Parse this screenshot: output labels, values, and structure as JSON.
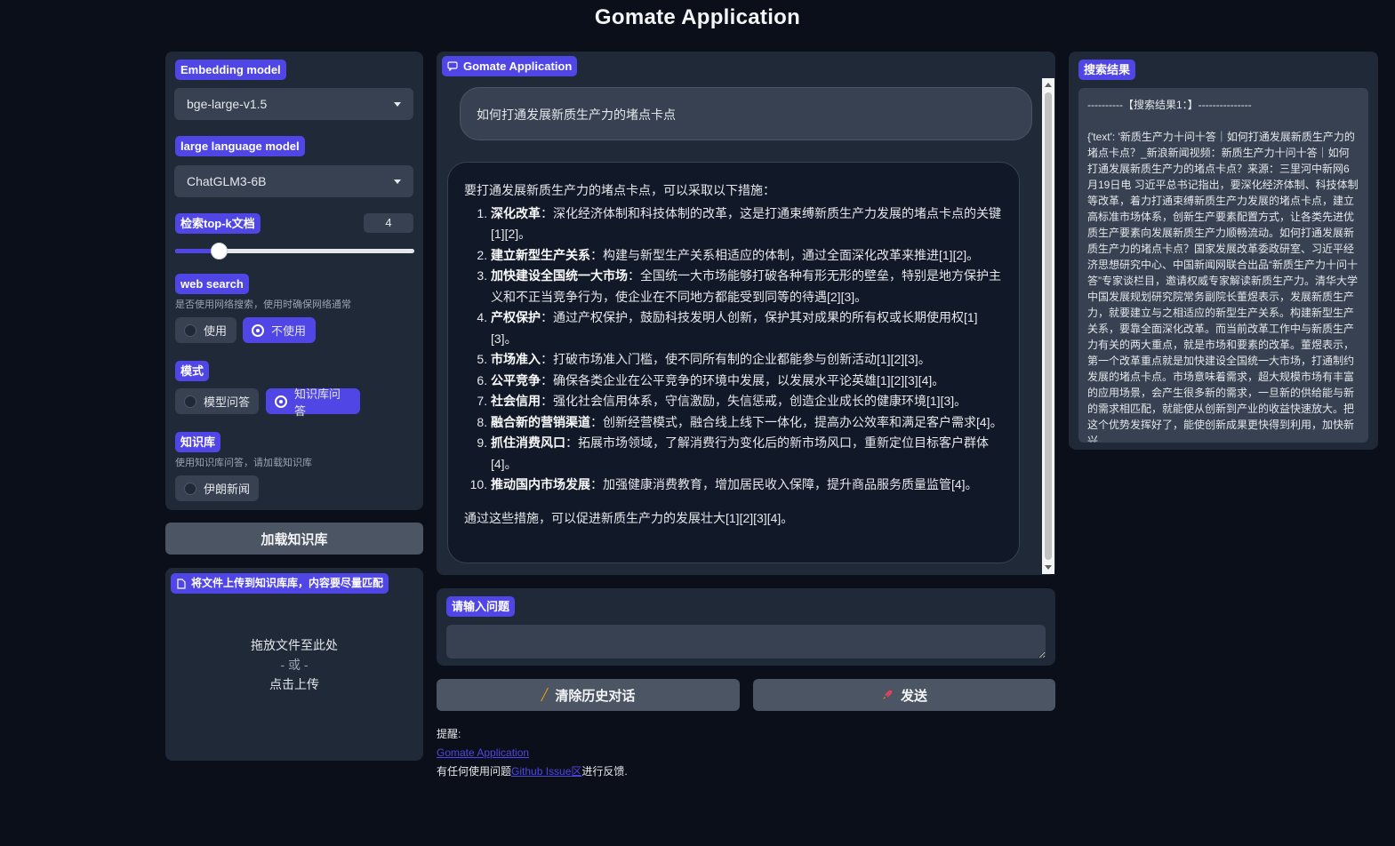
{
  "app": {
    "title": "Gomate Application"
  },
  "left": {
    "embedding_label": "Embedding model",
    "embedding_value": "bge-large-v1.5",
    "llm_label": "large language model",
    "llm_value": "ChatGLM3-6B",
    "topk_label": "检索top-k文档",
    "topk_value": "4",
    "topk_slider_fraction": 0.18,
    "web_search": {
      "label": "web search",
      "hint": "是否使用网络搜索，使用时确保网络通常",
      "options": [
        "使用",
        "不使用"
      ],
      "selected": "不使用"
    },
    "mode": {
      "label": "模式",
      "options": [
        "模型问答",
        "知识库问答"
      ],
      "selected": "知识库问答"
    },
    "kb": {
      "label": "知识库",
      "hint": "使用知识库问答，请加载知识库",
      "options": [
        "伊朗新闻"
      ]
    },
    "load_kb_button": "加载知识库",
    "upload": {
      "label": "将文件上传到知识库库，内容要尽量匹配",
      "drop_text": "拖放文件至此处",
      "or_text": "- 或 -",
      "click_text": "点击上传"
    }
  },
  "chat": {
    "label": "Gomate Application",
    "user_message": "如何打通发展新质生产力的堵点卡点",
    "bot_intro": "要打通发展新质生产力的堵点卡点，可以采取以下措施：",
    "bot_items": [
      {
        "title": "深化改革",
        "text": "：深化经济体制和科技体制的改革，这是打通束缚新质生产力发展的堵点卡点的关键[1][2]。"
      },
      {
        "title": "建立新型生产关系",
        "text": "：构建与新型生产关系相适应的体制，通过全面深化改革来推进[1][2]。"
      },
      {
        "title": "加快建设全国统一大市场",
        "text": "：全国统一大市场能够打破各种有形无形的壁垒，特别是地方保护主义和不正当竞争行为，使企业在不同地方都能受到同等的待遇[2][3]。"
      },
      {
        "title": "产权保护",
        "text": "：通过产权保护，鼓励科技发明人创新，保护其对成果的所有权或长期使用权[1][3]。"
      },
      {
        "title": "市场准入",
        "text": "：打破市场准入门槛，使不同所有制的企业都能参与创新活动[1][2][3]。"
      },
      {
        "title": "公平竞争",
        "text": "：确保各类企业在公平竞争的环境中发展，以发展水平论英雄[1][2][3][4]。"
      },
      {
        "title": "社会信用",
        "text": "：强化社会信用体系，守信激励，失信惩戒，创造企业成长的健康环境[1][3]。"
      },
      {
        "title": "融合新的营销渠道",
        "text": "：创新经营模式，融合线上线下一体化，提高办公效率和满足客户需求[4]。"
      },
      {
        "title": "抓住消费风口",
        "text": "：拓展市场领域，了解消费行为变化后的新市场风口，重新定位目标客户群体[4]。"
      },
      {
        "title": "推动国内市场发展",
        "text": "：加强健康消费教育，增加居民收入保障，提升商品服务质量监管[4]。"
      }
    ],
    "bot_conclusion": "通过这些措施，可以促进新质生产力的发展壮大[1][2][3][4]。",
    "input_label": "请输入问题",
    "input_value": "",
    "clear_button": "清除历史对话",
    "send_button": "发送"
  },
  "footer": {
    "reminder": "提醒:",
    "link_text": "Gomate Application",
    "issue_prefix": "有任何使用问题",
    "issue_link": "Github Issue区",
    "issue_suffix": "进行反馈."
  },
  "search": {
    "label": "搜索结果",
    "header": "----------【搜索结果1：】---------------",
    "text": "{'text': '新质生产力十问十答｜如何打通发展新质生产力的堵点卡点？_新浪新闻视频：新质生产力十问十答｜如何打通发展新质生产力的堵点卡点？来源：三里河中新网6月19日电 习近平总书记指出，要深化经济体制、科技体制等改革，着力打通束缚新质生产力发展的堵点卡点，建立高标准市场体系，创新生产要素配置方式，让各类先进优质生产要素向发展新质生产力顺畅流动。如何打通发展新质生产力的堵点卡点？国家发展改革委政研室、习近平经济思想研究中心、中国新闻网联合出品“新质生产力十问十答”专家谈栏目，邀请权威专家解读新质生产力。清华大学中国发展规划研究院常务副院长董煜表示，发展新质生产力，就要建立与之相适应的新型生产关系。构建新型生产关系，要靠全面深化改革。而当前改革工作中与新质生产力有关的两大重点，就是市场和要素的改革。董煜表示，第一个改革重点就是加快建设全国统一大市场，打通制约发展的堵点卡点。市场意味着需求，超大规模市场有丰富的应用场景，会产生很多新的需求，一旦新的供给能与新的需求相匹配，就能使从创新到产业的收益快速放大。把这个优势发挥好了，能使创新成果更快得到利用，加快新兴"
  }
}
